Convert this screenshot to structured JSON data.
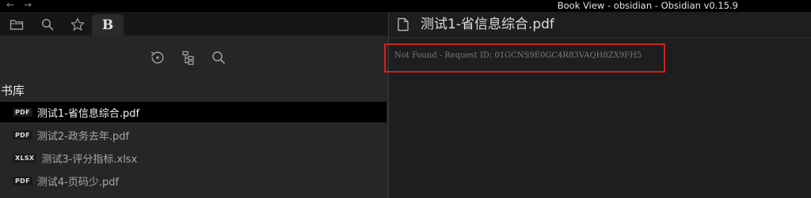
{
  "window": {
    "title": "Book View - obsidian - Obsidian v0.15.9",
    "back_arrow": "←",
    "forward_arrow": "→"
  },
  "left_tabs": [
    {
      "icon": "folder-icon"
    },
    {
      "icon": "search-icon"
    },
    {
      "icon": "star-icon"
    },
    {
      "icon": "book-view-icon",
      "label": "B",
      "active": true
    }
  ],
  "toolbar": [
    {
      "icon": "refresh-icon"
    },
    {
      "icon": "tree-view-icon"
    },
    {
      "icon": "search-icon"
    }
  ],
  "library": {
    "heading": "书库",
    "files": [
      {
        "type": "PDF",
        "name": "测试1-省信息综合.pdf",
        "active": true
      },
      {
        "type": "PDF",
        "name": "测试2-政务去年.pdf",
        "active": false
      },
      {
        "type": "XLSX",
        "name": "测试3-评分指标.xlsx",
        "active": false
      },
      {
        "type": "PDF",
        "name": "测试4-页码少.pdf",
        "active": false
      }
    ]
  },
  "document": {
    "icon": "document-icon",
    "title": "测试1-省信息综合.pdf",
    "error_message": "Not Found - Request ID: 01GCNS9E0GC4R83VAQH8ZX9FH5"
  },
  "colors": {
    "highlight_border": "#d02020",
    "active_row": "#000000",
    "background": "#1e1e1e"
  }
}
